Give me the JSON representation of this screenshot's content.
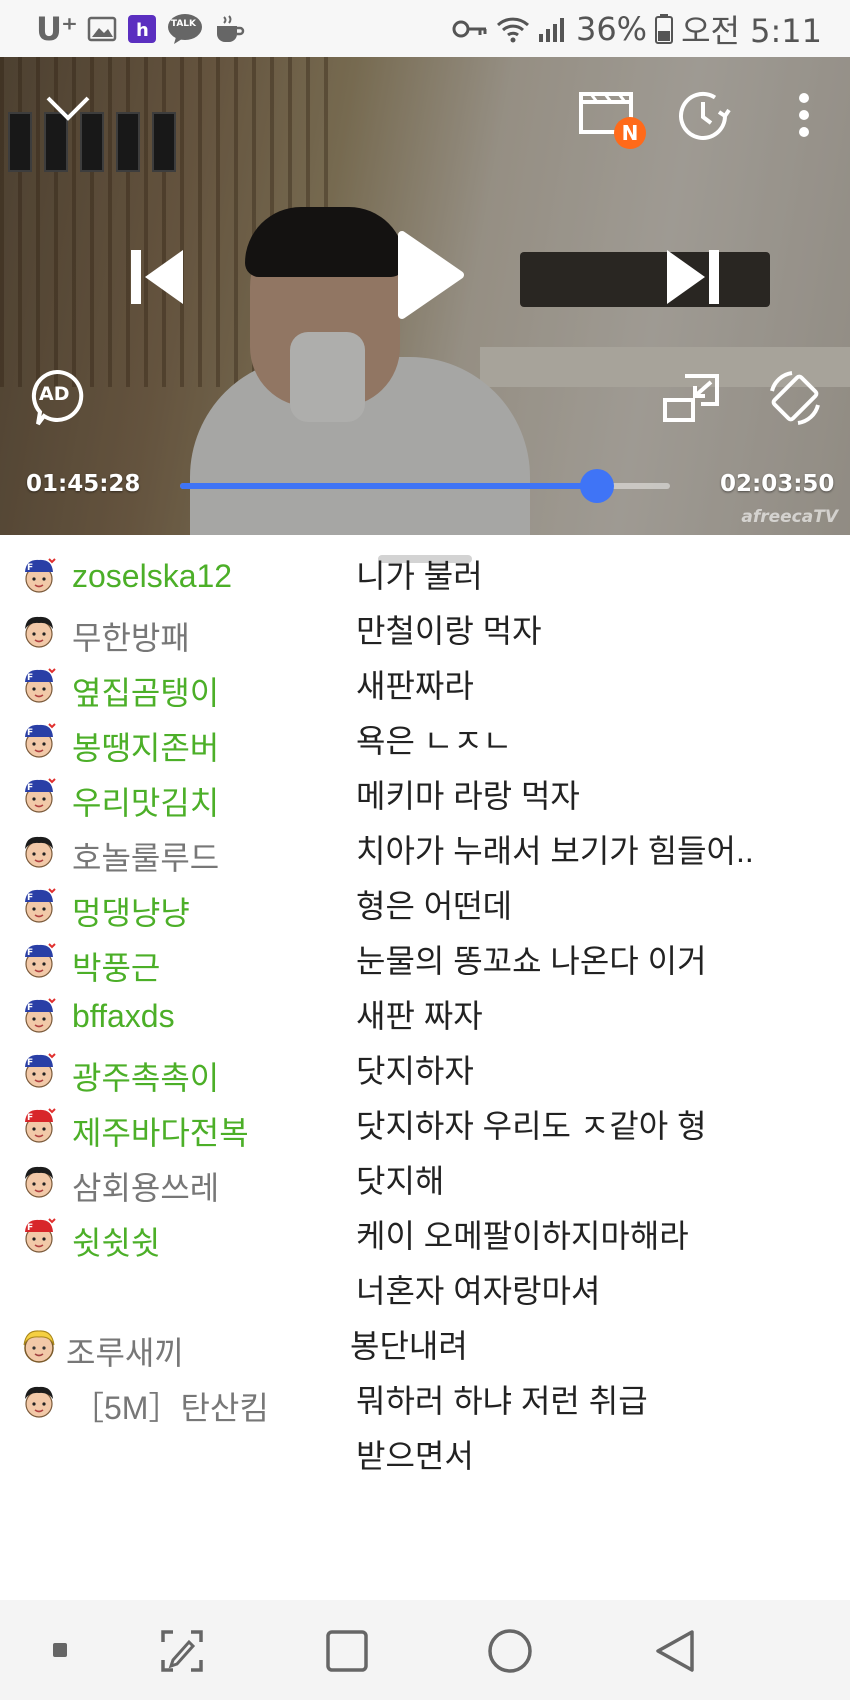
{
  "status_bar": {
    "carrier": "U⁺",
    "notification_icons": [
      "image-icon",
      "h-app-icon",
      "kakaotalk-icon",
      "coffee-icon"
    ],
    "talk_badge": "TALK",
    "battery_percent": "36%",
    "time": "오전 5:11"
  },
  "player": {
    "new_badge": "N",
    "ad_label": "AD",
    "current_time": "01:45:28",
    "total_time": "02:03:50",
    "progress": 0.85,
    "watermark": "afreecaTV",
    "accent_color": "#3f74f6"
  },
  "chat": {
    "messages": [
      {
        "user": "zoselska12",
        "lines": [
          "니가 불러"
        ],
        "type": "fan"
      },
      {
        "user": "무한방패",
        "lines": [
          "만철이랑 먹자"
        ],
        "type": "normal"
      },
      {
        "user": "옆집곰탱이",
        "lines": [
          "새판짜라"
        ],
        "type": "fan"
      },
      {
        "user": "봉땡지존버",
        "lines": [
          "욕은 ㄴㅈㄴ"
        ],
        "type": "fan"
      },
      {
        "user": "우리맛김치",
        "lines": [
          "메키마 라랑 먹자"
        ],
        "type": "fan"
      },
      {
        "user": "호놀룰루드",
        "lines": [
          "치아가 누래서 보기가 힘들어.."
        ],
        "type": "normal"
      },
      {
        "user": "멍댕냥냥",
        "lines": [
          "형은 어떤데"
        ],
        "type": "fan"
      },
      {
        "user": "박풍근",
        "lines": [
          "눈물의 똥꼬쇼 나온다 이거"
        ],
        "type": "fan"
      },
      {
        "user": "bffaxds",
        "lines": [
          "새판 짜자"
        ],
        "type": "fan"
      },
      {
        "user": "광주촉촉이",
        "lines": [
          "닷지하자"
        ],
        "type": "fan"
      },
      {
        "user": "제주바다전복",
        "lines": [
          "닷지하자 우리도 ㅈ같아 형"
        ],
        "type": "fan_red"
      },
      {
        "user": "삼회용쓰레",
        "lines": [
          "닷지해"
        ],
        "type": "normal"
      },
      {
        "user": "쉿쉿쉿",
        "lines": [
          "케이 오메팔이하지마해라",
          "너혼자 여자랑마셔"
        ],
        "type": "fan_red"
      },
      {
        "user": "조루새끼",
        "lines": [
          "봉단내려"
        ],
        "type": "blonde"
      },
      {
        "user": "［5M］탄산킴",
        "lines": [
          "뭐하러 하냐 저런 취급",
          "받으면서"
        ],
        "type": "normal"
      }
    ]
  },
  "colors": {
    "fan_name": "#4caf28",
    "normal_name": "#777777",
    "message_text": "#222222"
  }
}
